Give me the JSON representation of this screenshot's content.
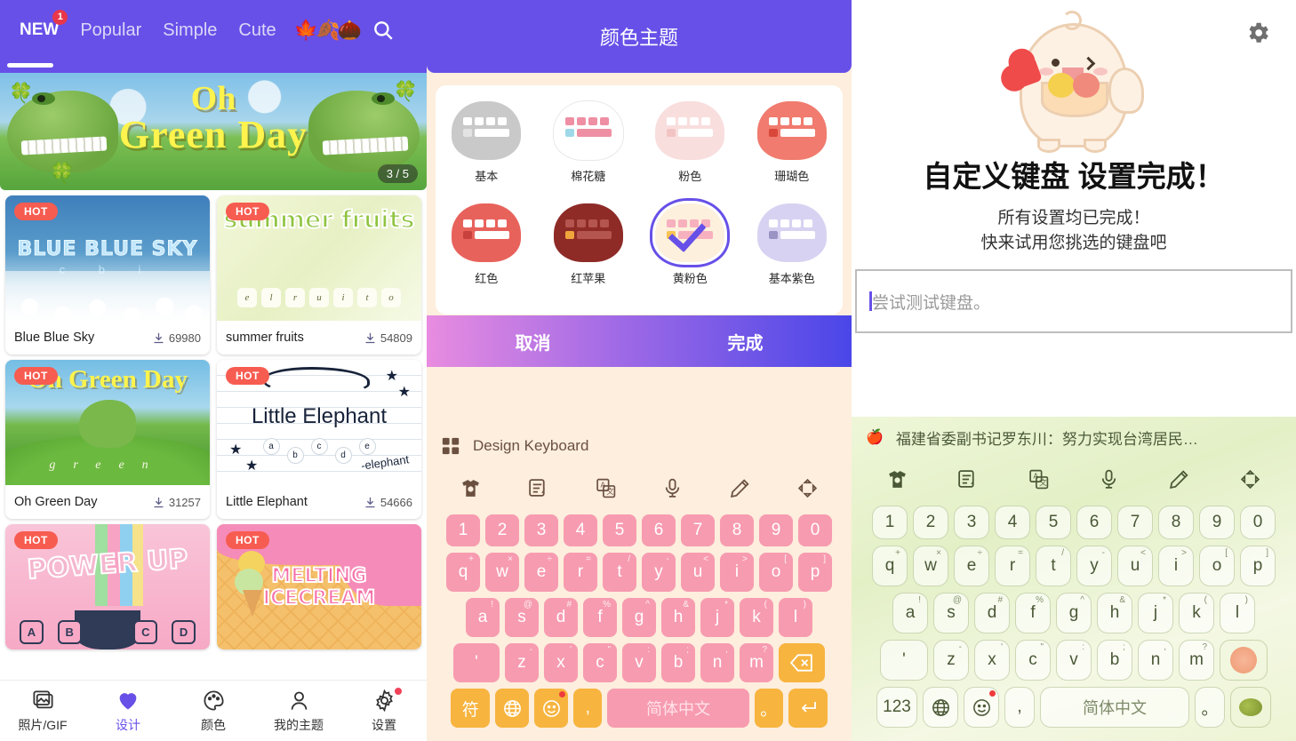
{
  "store": {
    "tabs": [
      {
        "label": "NEW",
        "badge": "1",
        "active": true
      },
      {
        "label": "Popular",
        "badge": "",
        "active": false
      },
      {
        "label": "Simple",
        "badge": "",
        "active": false
      },
      {
        "label": "Cute",
        "badge": "",
        "active": false
      }
    ],
    "season_icons": "🍁🍂🌰",
    "search_icon": "search-icon",
    "banner": {
      "title_line1": "Oh",
      "title_line2": "Green Day",
      "pager": "3 / 5"
    },
    "hot_badge": "HOT",
    "themes": [
      {
        "name": "Blue Blue Sky",
        "downloads": "69980",
        "art_text": "BLUE BLUE SKY",
        "hot": "HOT"
      },
      {
        "name": "summer fruits",
        "downloads": "54809",
        "art_text": "summer fruits",
        "hot": "HOT"
      },
      {
        "name": "Oh Green Day",
        "downloads": "31257",
        "art_text": "Oh Green Day",
        "hot": "HOT"
      },
      {
        "name": "Little Elephant",
        "downloads": "54666",
        "art_text": "Little Elephant",
        "hot": "HOT"
      },
      {
        "name": "POWER UP",
        "downloads": "",
        "art_text": "POWER UP",
        "hot": "HOT"
      },
      {
        "name": "MELTING ICECREAM",
        "downloads": "",
        "art_text": "MELTING ICECREAM",
        "hot": "HOT"
      }
    ],
    "nav": [
      {
        "label": "照片/GIF",
        "icon": "photo-gif-icon",
        "active": false,
        "dot": false
      },
      {
        "label": "设计",
        "icon": "heart-icon",
        "active": true,
        "dot": false
      },
      {
        "label": "颜色",
        "icon": "palette-icon",
        "active": false,
        "dot": false
      },
      {
        "label": "我的主题",
        "icon": "person-icon",
        "active": false,
        "dot": false
      },
      {
        "label": "设置",
        "icon": "gear-icon",
        "active": false,
        "dot": true
      }
    ],
    "accent_color": "#6750e8",
    "hot_color": "#f75c51"
  },
  "color_theme": {
    "header_title": "颜色主题",
    "items_row1": [
      {
        "label": "基本",
        "bubble": "#c9c9c9",
        "key": "#ffffff",
        "accent": "#e3e3e3",
        "selected": false
      },
      {
        "label": "棉花糖",
        "bubble": "#ffffff",
        "key": "#ef8fa3",
        "accent": "#9fd8e8",
        "selected": false
      },
      {
        "label": "粉色",
        "bubble": "#f9dede",
        "key": "#ffffff",
        "accent": "#f2c3c3",
        "selected": false
      },
      {
        "label": "珊瑚色",
        "bubble": "#f07b6e",
        "key": "#ffffff",
        "accent": "#d9463a",
        "selected": false
      }
    ],
    "items_row2": [
      {
        "label": "红色",
        "bubble": "#e8625c",
        "key": "#ffffff",
        "accent": "#c9413c",
        "selected": false
      },
      {
        "label": "红苹果",
        "bubble": "#8e2b27",
        "key": "#b4554f",
        "accent": "#f0a63c",
        "selected": false
      },
      {
        "label": "黄粉色",
        "bubble": "#fdf0dd",
        "key": "#f7b0be",
        "accent": "#f7c451",
        "selected": true
      },
      {
        "label": "基本紫色",
        "bubble": "#d8d2f2",
        "key": "#ffffff",
        "accent": "#9a94c4",
        "selected": false
      }
    ],
    "cancel_label": "取消",
    "done_label": "完成",
    "selected_label": "黄粉色",
    "gradient_from": "#e88ce0",
    "gradient_to": "#4a46e8"
  },
  "keyboard_pink": {
    "suggest_text": "Design Keyboard",
    "apps_icon": "apps-grid-icon",
    "tools": [
      "theme-shirt-icon",
      "clipboard-icon",
      "translate-icon",
      "microphone-icon",
      "pencil-icon",
      "resize-icon"
    ],
    "row_num": [
      "1",
      "2",
      "3",
      "4",
      "5",
      "6",
      "7",
      "8",
      "9",
      "0"
    ],
    "row_q": [
      "q",
      "w",
      "e",
      "r",
      "t",
      "y",
      "u",
      "i",
      "o",
      "p"
    ],
    "row_q_sup": [
      "+",
      "×",
      "÷",
      "=",
      "/",
      "-",
      "<",
      ">",
      "[",
      "]"
    ],
    "row_a": [
      "a",
      "s",
      "d",
      "f",
      "g",
      "h",
      "j",
      "k",
      "l"
    ],
    "row_a_sup": [
      "!",
      "@",
      "#",
      "%",
      "^",
      "&",
      "*",
      "(",
      ")"
    ],
    "row_z": [
      "z",
      "x",
      "c",
      "v",
      "b",
      "n",
      "m"
    ],
    "row_z_sup": [
      "-",
      "'",
      "\"",
      ":",
      ";",
      ",",
      "?"
    ],
    "shift_label": "'",
    "backspace_icon": "backspace-icon",
    "sym_label": "符",
    "globe_icon": "globe-icon",
    "emoji_icon": "emoji-icon",
    "comma_label": ",",
    "space_label": "简体中文",
    "period_label": "。",
    "enter_icon": "enter-icon"
  },
  "setup_done": {
    "gear_icon": "gear-icon",
    "mascot": "bear-with-bowl-mascot",
    "title": "自定义键盘 设置完成！",
    "subtitle_line1": "所有设置均已完成！",
    "subtitle_line2": "快来试用您挑选的键盘吧",
    "input_placeholder": "尝试测试键盘。",
    "input_value": ""
  },
  "keyboard_green": {
    "suggest_icon": "apple-icon",
    "suggest_text": "福建省委副书记罗东川：努力实现台湾居民…",
    "tools": [
      "theme-shirt-icon",
      "clipboard-icon",
      "translate-icon",
      "microphone-icon",
      "pencil-icon",
      "resize-icon"
    ],
    "row_num": [
      "1",
      "2",
      "3",
      "4",
      "5",
      "6",
      "7",
      "8",
      "9",
      "0"
    ],
    "row_q": [
      "q",
      "w",
      "e",
      "r",
      "t",
      "y",
      "u",
      "i",
      "o",
      "p"
    ],
    "row_q_sup": [
      "+",
      "×",
      "÷",
      "=",
      "/",
      "-",
      "<",
      ">",
      "[",
      "]"
    ],
    "row_a": [
      "a",
      "s",
      "d",
      "f",
      "g",
      "h",
      "j",
      "k",
      "l"
    ],
    "row_a_sup": [
      "!",
      "@",
      "#",
      "%",
      "^",
      "&",
      "*",
      "(",
      ")"
    ],
    "row_z": [
      "z",
      "x",
      "c",
      "v",
      "b",
      "n",
      "m"
    ],
    "row_z_sup": [
      "-",
      "'",
      "\"",
      ":",
      ";",
      ",",
      "?"
    ],
    "shift_label": "'",
    "backspace_icon": "grapefruit-backspace-icon",
    "sym_label": "123",
    "globe_icon": "globe-icon",
    "emoji_icon": "emoji-icon",
    "comma_label": ",",
    "space_label": "简体中文",
    "period_label": "。",
    "enter_icon": "olive-enter-icon"
  }
}
